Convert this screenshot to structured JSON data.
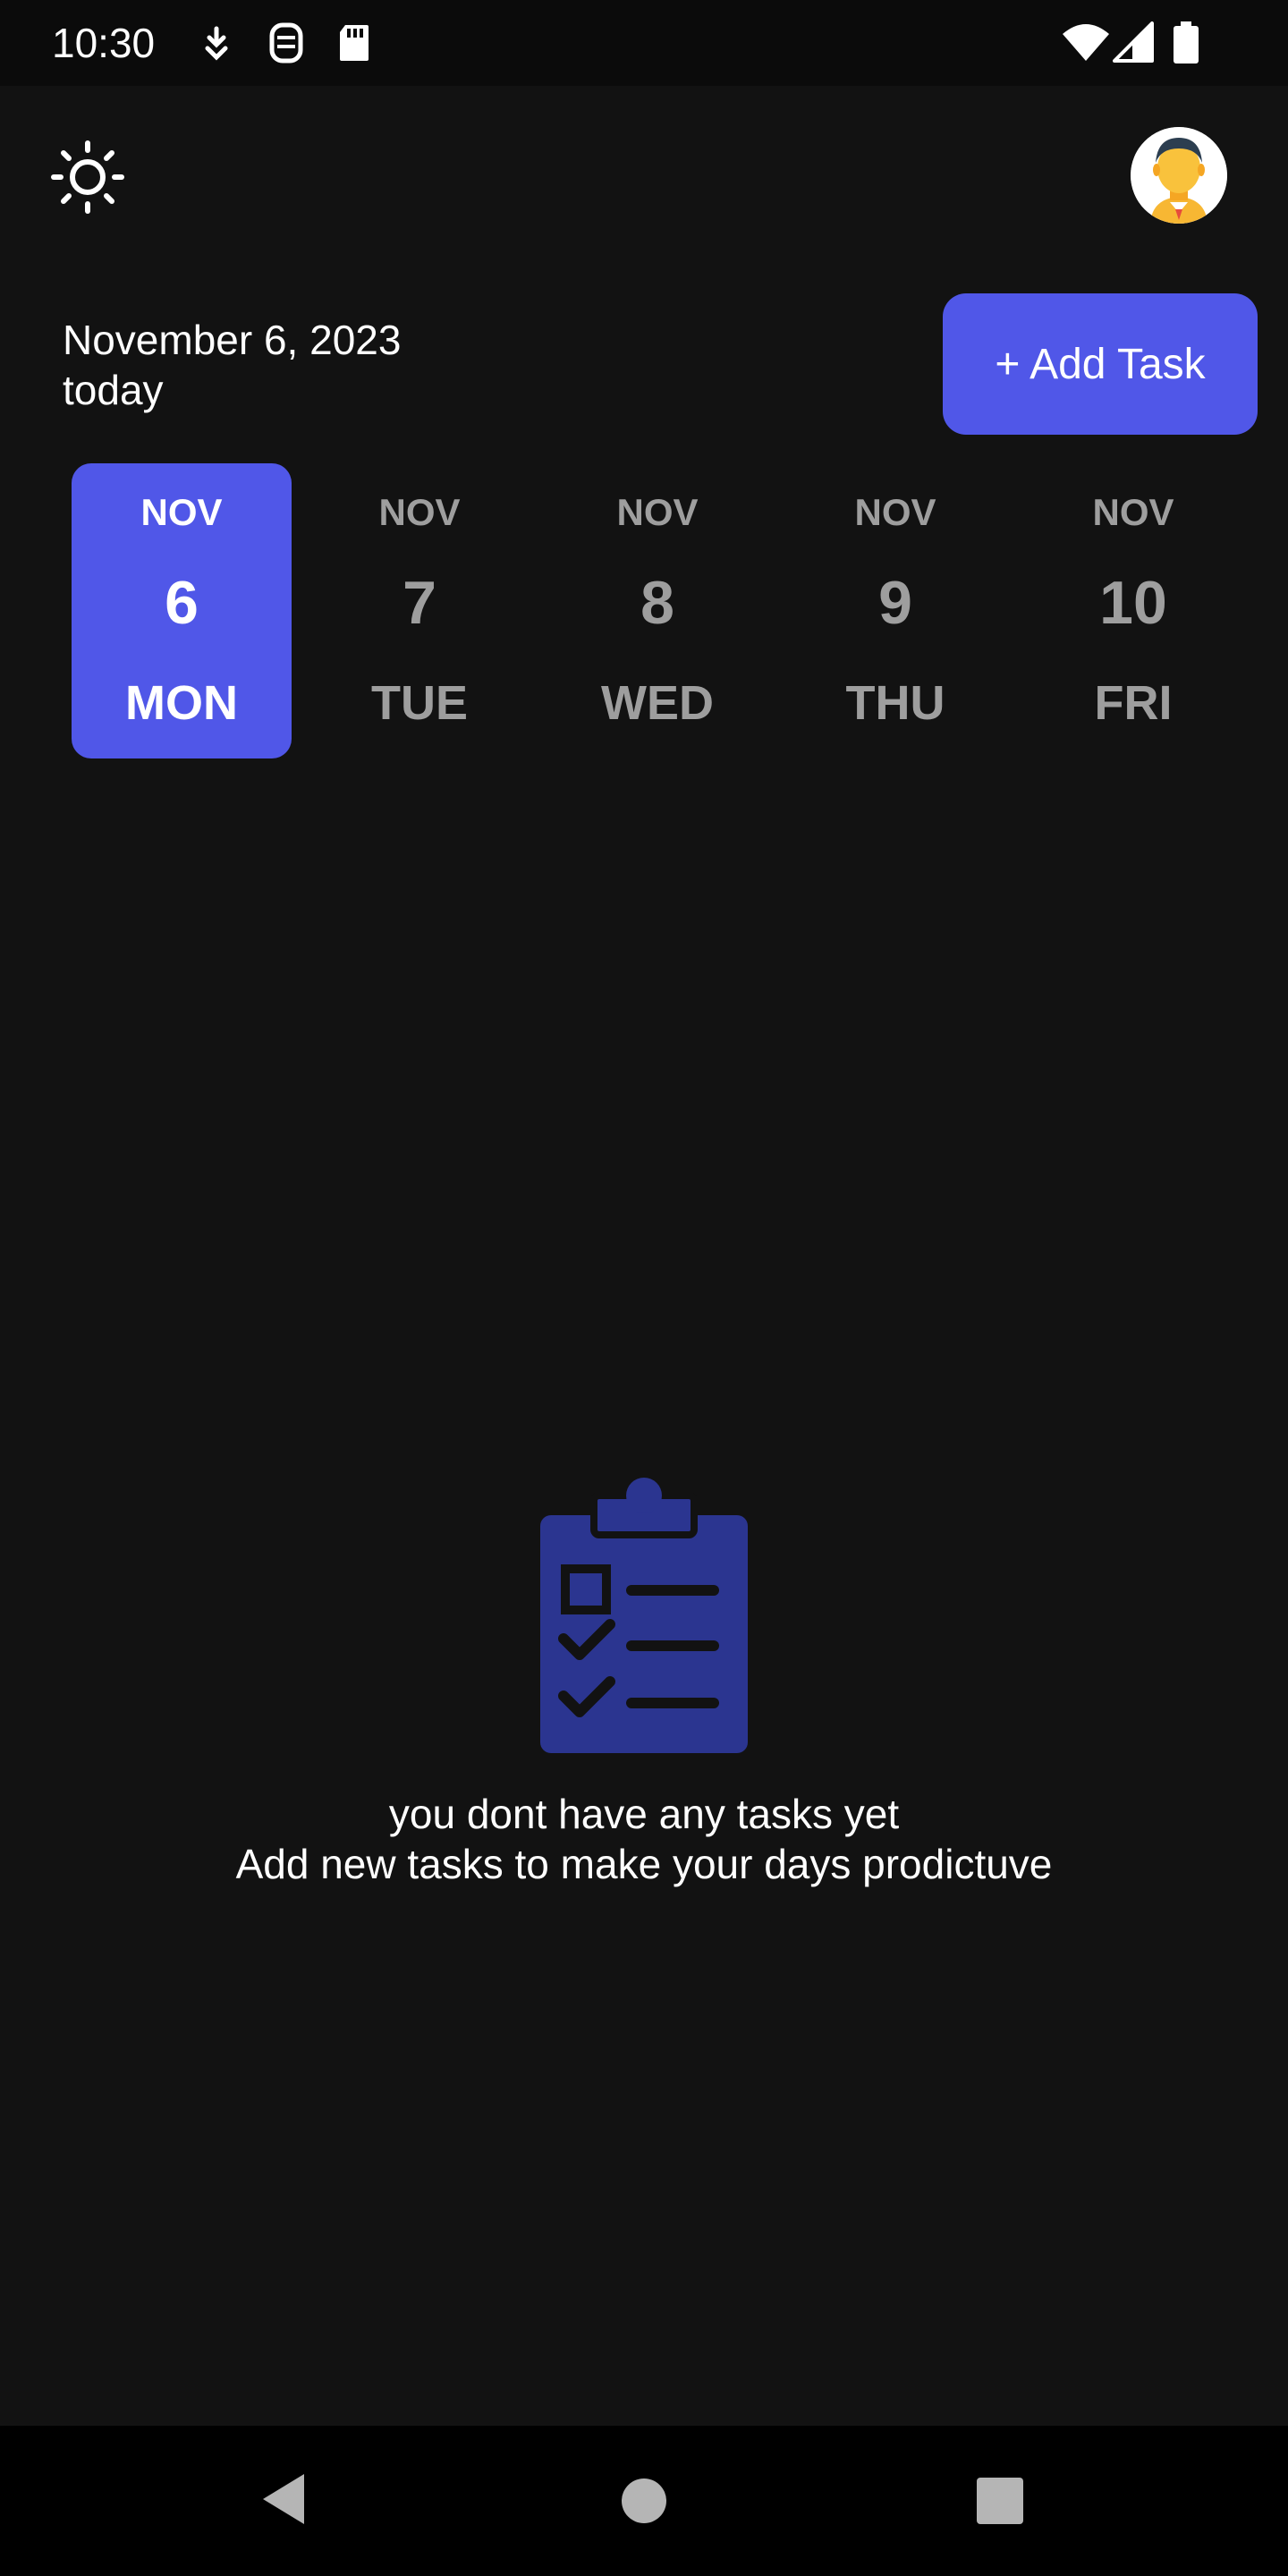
{
  "status_bar": {
    "time": "10:30",
    "icons": [
      "notification-download-icon",
      "sim-card-manager-icon",
      "sd-card-icon",
      "wifi-icon",
      "cell-signal-icon",
      "battery-icon"
    ]
  },
  "header": {
    "theme_icon": "sun-icon",
    "avatar_icon": "user-avatar"
  },
  "date_header": {
    "date": "November 6, 2023",
    "label": "today"
  },
  "add_task_button": {
    "label": "+ Add Task"
  },
  "date_picker": {
    "selected_index": 0,
    "days": [
      {
        "month": "NOV",
        "day": "6",
        "weekday": "MON"
      },
      {
        "month": "NOV",
        "day": "7",
        "weekday": "TUE"
      },
      {
        "month": "NOV",
        "day": "8",
        "weekday": "WED"
      },
      {
        "month": "NOV",
        "day": "9",
        "weekday": "THU"
      },
      {
        "month": "NOV",
        "day": "10",
        "weekday": "FRI"
      }
    ]
  },
  "empty_state": {
    "icon": "clipboard-checklist-icon",
    "title": "you dont have any tasks yet",
    "subtitle": "Add new tasks to make your days prodictuve"
  },
  "colors": {
    "background": "#121212",
    "accent": "#5057e8",
    "illustration": "#2b3590",
    "inactive_text": "#9e9e9e"
  },
  "nav_bar": {
    "icons": [
      "back-icon",
      "home-icon",
      "recents-icon"
    ]
  }
}
